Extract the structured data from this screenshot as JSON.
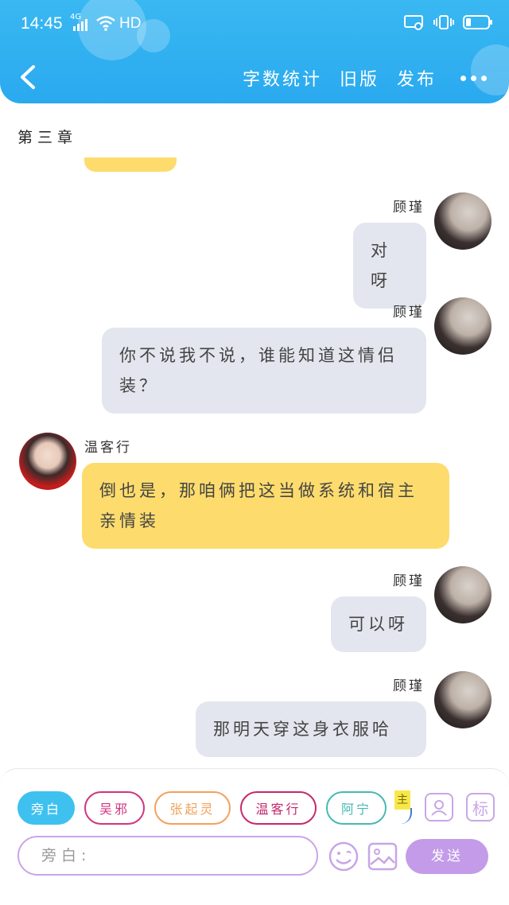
{
  "status_bar": {
    "time": "14:45",
    "network_small": "4G",
    "hd": "HD"
  },
  "nav": {
    "word_count_label": "字数统计",
    "old_version_label": "旧版",
    "publish_label": "发布"
  },
  "chapter_title": "第三章",
  "messages": [
    {
      "name": "顾瑾",
      "text": "对呀",
      "side": "right",
      "bubble_color": "#e3e6ee"
    },
    {
      "name": "顾瑾",
      "text": "你不说我不说，谁能知道这情侣装？",
      "side": "right",
      "bubble_color": "#e3e6ee"
    },
    {
      "name": "温客行",
      "text": "倒也是，那咱俩把这当做系统和宿主亲情装",
      "side": "left",
      "bubble_color": "#fddc6d"
    },
    {
      "name": "顾瑾",
      "text": "可以呀",
      "side": "right",
      "bubble_color": "#e3e6ee"
    },
    {
      "name": "顾瑾",
      "text": "那明天穿这身衣服哈",
      "side": "right",
      "bubble_color": "#e3e6ee"
    }
  ],
  "composer": {
    "roles": [
      {
        "label": "旁白",
        "color": "#3fc1ef"
      },
      {
        "label": "吴邪",
        "color": "#d0357f"
      },
      {
        "label": "张起灵",
        "color": "#f2a25b"
      },
      {
        "label": "温客行",
        "color": "#c32a6b"
      },
      {
        "label": "阿宁",
        "color": "#48b8b6"
      }
    ],
    "partial_role": "主",
    "label_tool": "标",
    "input_placeholder": "旁白:",
    "send_label": "发送"
  },
  "colors": {
    "accent": "#2aa9ef",
    "purple": "#c39be8"
  }
}
